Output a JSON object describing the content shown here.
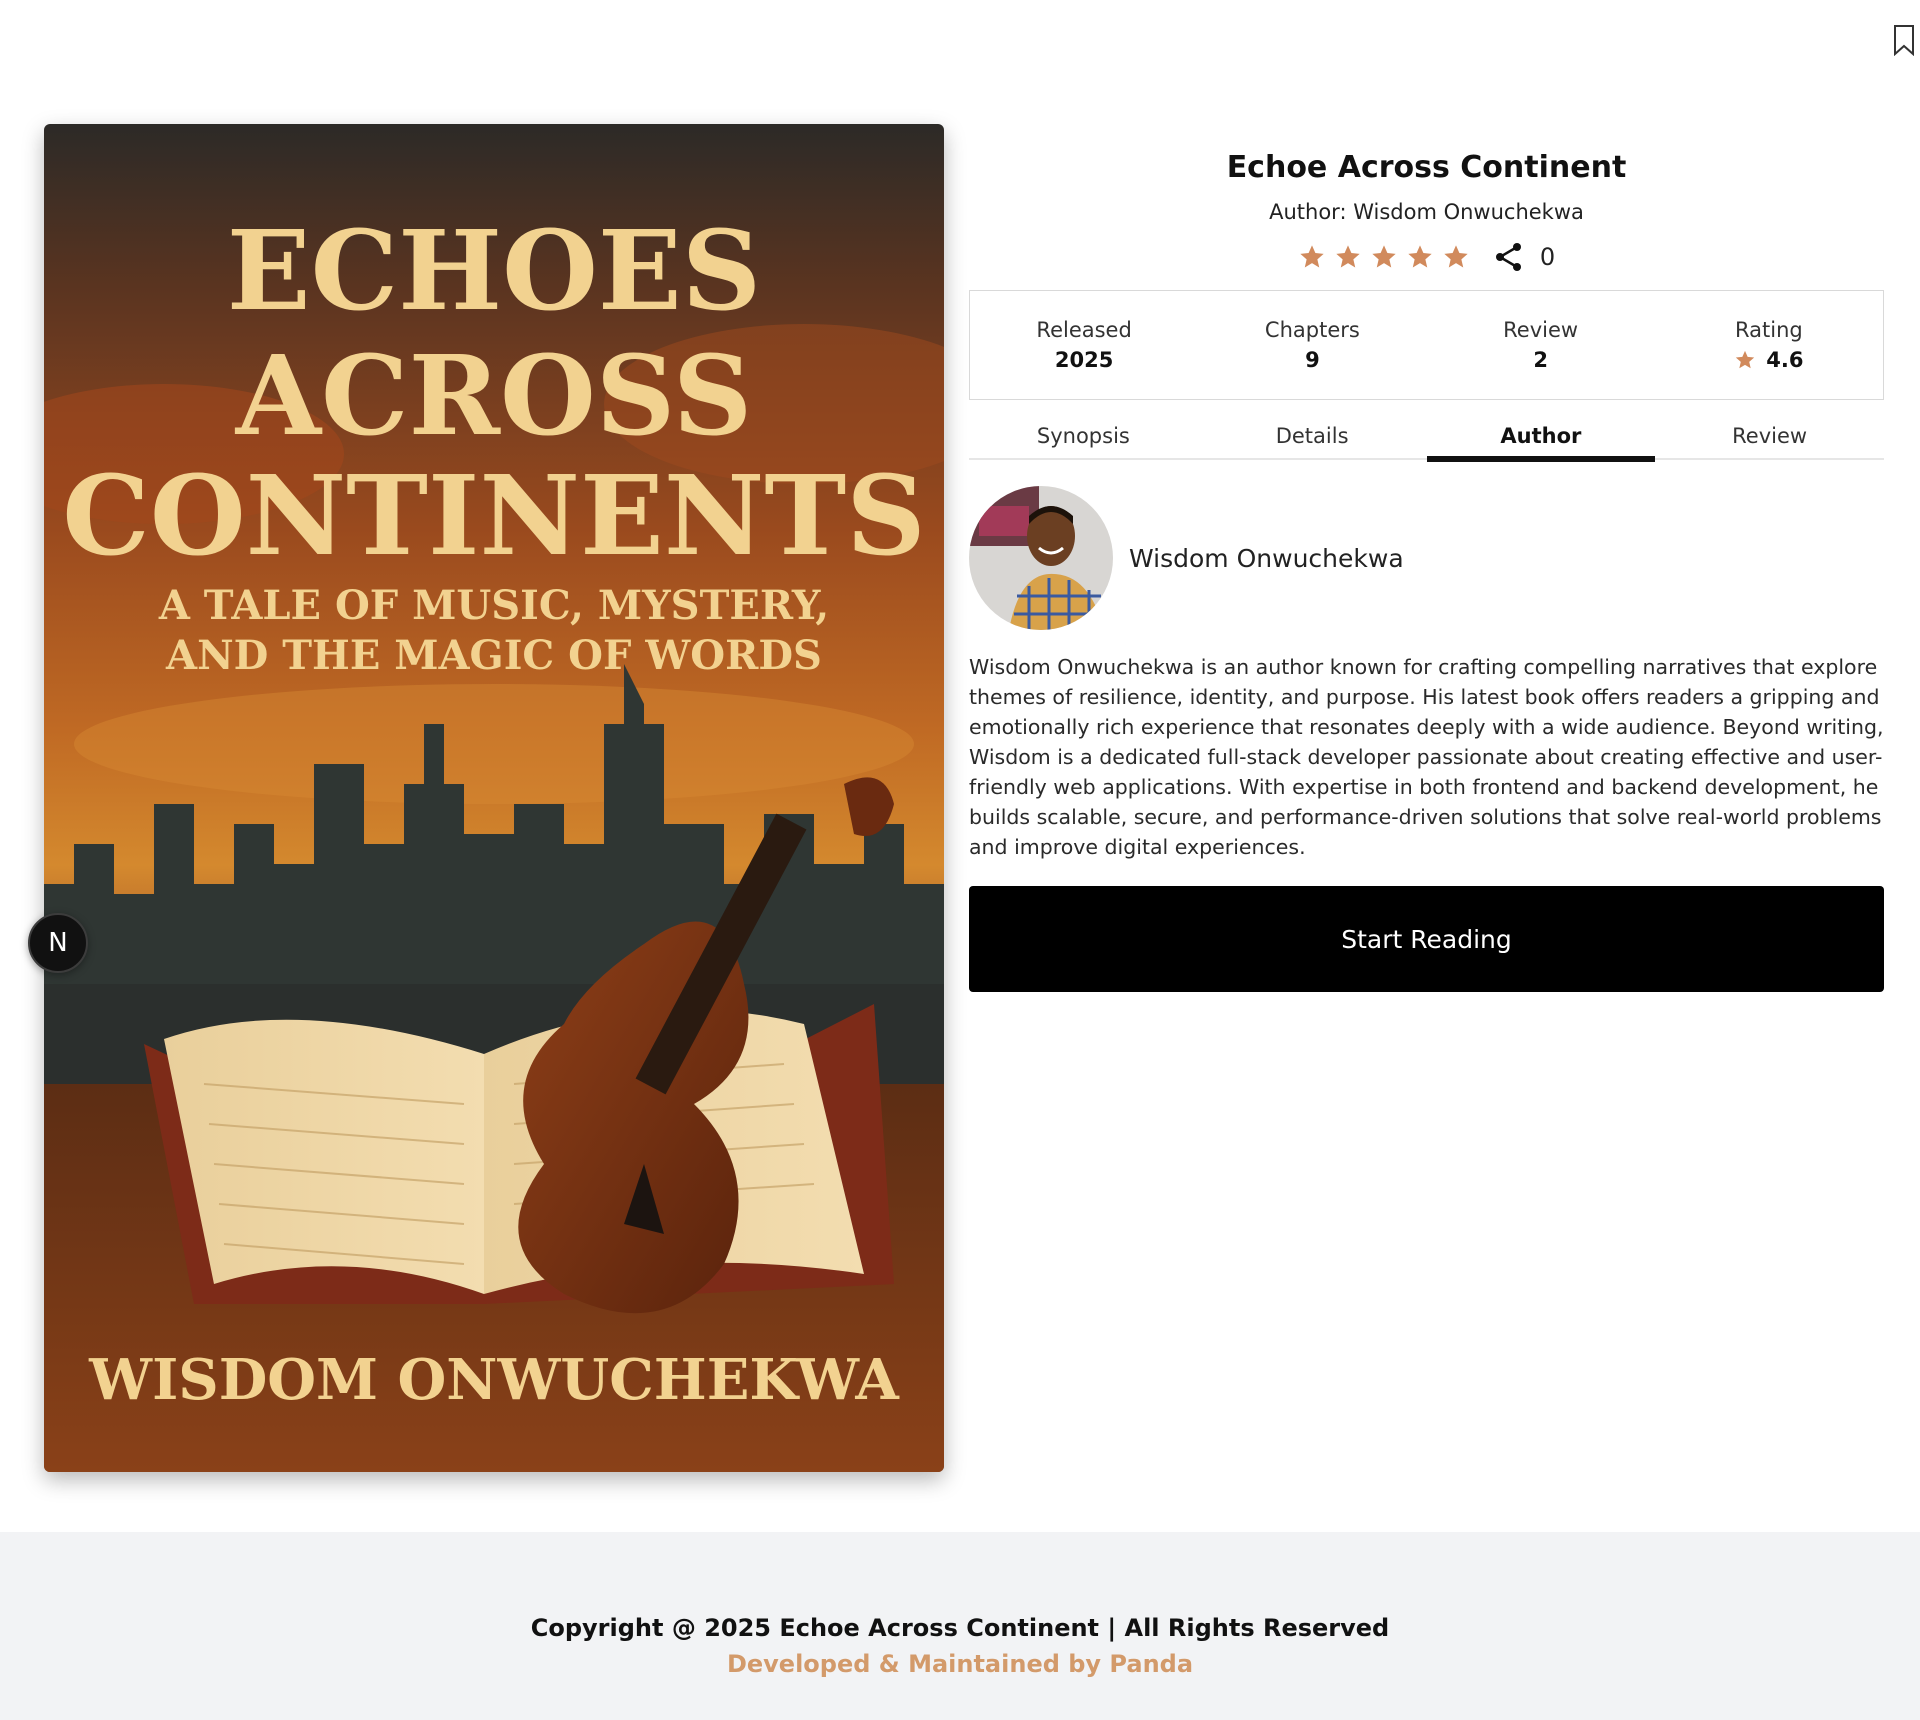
{
  "bookmark": {
    "icon": "bookmark-icon"
  },
  "cover": {
    "title_line1": "ECHOES",
    "title_line2": "ACROSS",
    "title_line3": "CONTINENTS",
    "subtitle_line1": "A TALE OF MUSIC, MYSTERY,",
    "subtitle_line2": "AND THE MAGIC OF WORDS",
    "author": "WISDOM ONWUCHEKWA"
  },
  "n_badge": {
    "label": "N"
  },
  "book": {
    "title": "Echoe Across Continent",
    "author_line": "Author: Wisdom Onwuchekwa",
    "stars": 5,
    "share_count": "0"
  },
  "stats": {
    "released_label": "Released",
    "released_value": "2025",
    "chapters_label": "Chapters",
    "chapters_value": "9",
    "review_label": "Review",
    "review_value": "2",
    "rating_label": "Rating",
    "rating_value": "4.6"
  },
  "tabs": {
    "synopsis": "Synopsis",
    "details": "Details",
    "author": "Author",
    "review": "Review",
    "active": "Author"
  },
  "author": {
    "name": "Wisdom Onwuchekwa",
    "bio": "Wisdom Onwuchekwa is an author known for crafting compelling narratives that explore themes of resilience, identity, and purpose. His latest book offers readers a gripping and emotionally rich experience that resonates deeply with a wide audience. Beyond writing, Wisdom is a dedicated full-stack developer passionate about creating effective and user-friendly web applications. With expertise in both frontend and backend development, he builds scalable, secure, and performance-driven solutions that solve real-world problems and improve digital experiences."
  },
  "cta": {
    "start_reading": "Start Reading"
  },
  "footer": {
    "copyright": "Copyright @ 2025 Echoe Across Continent | All Rights Reserved",
    "developer": "Developed & Maintained by Panda"
  },
  "colors": {
    "accent": "#d39a6a",
    "star": "#d18a5c",
    "button": "#000000",
    "footer_bg": "#f2f3f5"
  }
}
